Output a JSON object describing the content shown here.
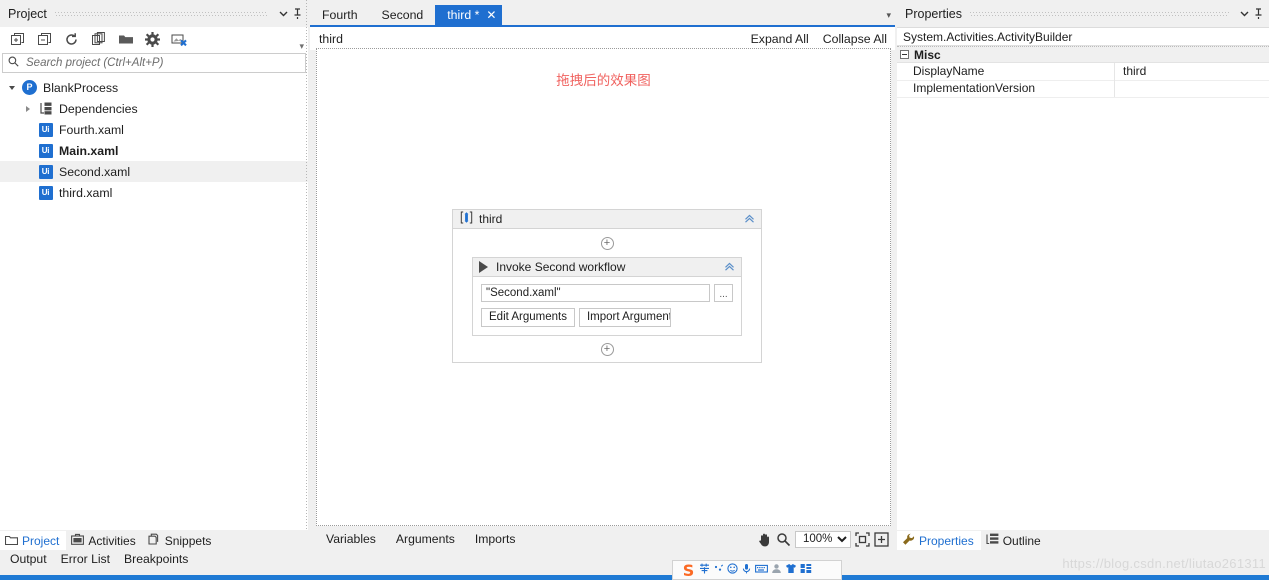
{
  "project_panel": {
    "title": "Project",
    "toolbar": [
      {
        "name": "expand-all-icon",
        "label": "Expand All"
      },
      {
        "name": "collapse-all-icon",
        "label": "Collapse All"
      },
      {
        "name": "refresh-icon",
        "label": "Refresh"
      },
      {
        "name": "copy-icon",
        "label": "Copy"
      },
      {
        "name": "open-folder-icon",
        "label": "Open Folder"
      },
      {
        "name": "settings-icon",
        "label": "Project Settings"
      },
      {
        "name": "remove-unused-icon",
        "label": "Remove Unused"
      }
    ],
    "search": {
      "value": "",
      "placeholder": "Search project (Ctrl+Alt+P)"
    },
    "tree": [
      {
        "label": "BlankProcess",
        "icon": "process-icon",
        "indent": 0,
        "expander": "open",
        "bold": false,
        "selected": false
      },
      {
        "label": "Dependencies",
        "icon": "dependencies-icon",
        "indent": 1,
        "expander": "closed",
        "bold": false,
        "selected": false
      },
      {
        "label": "Fourth.xaml",
        "icon": "xaml-icon",
        "indent": 2,
        "expander": "none",
        "bold": false,
        "selected": false
      },
      {
        "label": "Main.xaml",
        "icon": "xaml-icon",
        "indent": 2,
        "expander": "none",
        "bold": true,
        "selected": false
      },
      {
        "label": "Second.xaml",
        "icon": "xaml-icon",
        "indent": 2,
        "expander": "none",
        "bold": false,
        "selected": true
      },
      {
        "label": "third.xaml",
        "icon": "xaml-icon",
        "indent": 2,
        "expander": "none",
        "bold": false,
        "selected": false
      }
    ],
    "bottom_tabs": [
      {
        "label": "Project",
        "icon": "folder-icon",
        "active": true
      },
      {
        "label": "Activities",
        "icon": "activities-icon",
        "active": false
      },
      {
        "label": "Snippets",
        "icon": "snippets-icon",
        "active": false
      }
    ]
  },
  "designer": {
    "document_tabs": [
      {
        "label": "Fourth",
        "active": false,
        "modified": false
      },
      {
        "label": "Second",
        "active": false,
        "modified": false
      },
      {
        "label": "third *",
        "active": true,
        "modified": true
      }
    ],
    "breadcrumb": "third",
    "expand_all_label": "Expand All",
    "collapse_all_label": "Collapse All",
    "annotation": "拖拽后的效果图",
    "annotation_color": "#f0625f",
    "sequence": {
      "name": "third",
      "icon": "sequence-icon",
      "activity": {
        "name": "Invoke Second workflow",
        "icon": "invoke-workflow-icon",
        "path_value": "\"Second.xaml\"",
        "browse_label": "...",
        "edit_arguments_label": "Edit Arguments",
        "import_arguments_label": "Import Arguments"
      }
    },
    "bottom_tabs": [
      "Variables",
      "Arguments",
      "Imports"
    ],
    "pan_icon": "hand-icon",
    "zoom_icon": "magnifier-icon",
    "zoom_level": "100%",
    "fit_icons": [
      "fit-to-screen-icon",
      "reset-zoom-icon"
    ]
  },
  "properties_panel": {
    "title": "Properties",
    "type_name": "System.Activities.ActivityBuilder",
    "category": "Misc",
    "rows": [
      {
        "key": "DisplayName",
        "value": "third"
      },
      {
        "key": "ImplementationVersion",
        "value": ""
      }
    ],
    "bottom_tabs": [
      {
        "label": "Properties",
        "icon": "wrench-icon",
        "active": true
      },
      {
        "label": "Outline",
        "icon": "outline-icon",
        "active": false
      }
    ]
  },
  "status_bar": {
    "tabs": [
      "Output",
      "Error List",
      "Breakpoints"
    ],
    "watermark": "https://blog.csdn.net/liutao261311"
  },
  "ime": {
    "logo": "S",
    "buttons": [
      "ime-chinese-icon",
      "ime-punctuation-icon",
      "ime-emoji-icon",
      "ime-voice-icon",
      "ime-keyboard-icon",
      "ime-user-icon",
      "ime-skin-icon",
      "ime-toolbox-icon"
    ]
  },
  "colors": {
    "accent": "#1f6fd0",
    "panel_bg": "#f0f0f0",
    "annotation": "#f0625f"
  }
}
